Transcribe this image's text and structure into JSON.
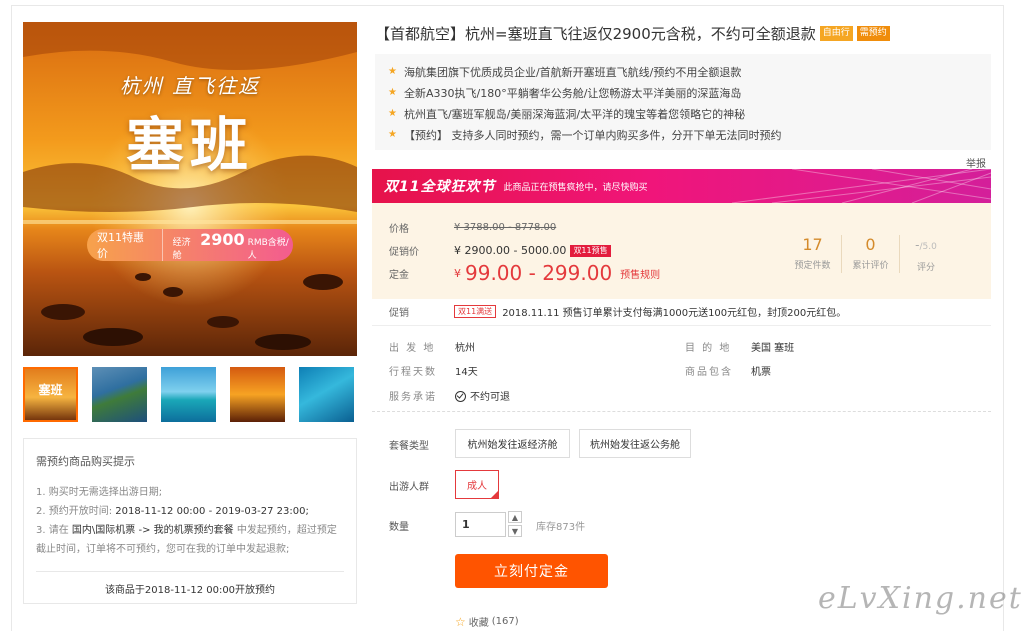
{
  "product": {
    "title": "【首都航空】杭州=塞班直飞往返仅2900元含税，不约可全额退款",
    "tags": [
      "自由行",
      "需预约"
    ]
  },
  "image": {
    "subtitle": "杭州 直飞往返",
    "title": "塞班",
    "pill_left": "双11特惠价",
    "pill_prefix": "经济舱",
    "pill_price": "2900",
    "pill_suffix": "RMB含税/人"
  },
  "thumbnails": [
    {
      "caption": "塞班"
    },
    {
      "caption": ""
    },
    {
      "caption": ""
    },
    {
      "caption": ""
    },
    {
      "caption": ""
    }
  ],
  "notice": {
    "title": "需预约商品购买提示",
    "line1": "1. 购买时无需选择出游日期;",
    "line2_label": "2. 预约开放时间:",
    "line2_value": "2018-11-12 00:00 - 2019-03-27 23:00;",
    "line3_a": "3. 请在",
    "line3_b": "国内\\国际机票 -> 我的机票预约套餐",
    "line3_c": "中发起预约，超过预定",
    "line4": "截止时间，订单将不可预约，您可在我的订单中发起退款;",
    "footer": "该商品于2018-11-12 00:00开放预约"
  },
  "features": [
    "海航集团旗下优质成员企业/首航新开塞班直飞航线/预约不用全额退款",
    "全新A330执飞/180°平躺奢华公务舱/让您畅游太平洋美丽的深蓝海岛",
    "杭州直飞/塞班军舰岛/美丽深海蓝洞/太平洋的瑰宝等着您领略它的神秘",
    "【预约】 支持多人同时预约，需一个订单内购买多件，分开下单无法同时预约"
  ],
  "report": "举报",
  "banner": {
    "logo": "双11全球狂欢节",
    "text": "此商品正在预售疯抢中，请尽快购买"
  },
  "price": {
    "label_price": "价格",
    "original": "¥ 3788.00 - 8778.00",
    "label_promo": "促销价",
    "promo": "¥ 2900.00 - 5000.00",
    "promo_badge": "双11预售",
    "label_deposit": "定金",
    "deposit_currency": "¥",
    "deposit": "99.00 - 299.00",
    "deposit_rule": "预售规则"
  },
  "stats": [
    {
      "num": "17",
      "label": "预定件数"
    },
    {
      "num": "0",
      "label": "累计评价"
    },
    {
      "num": "-",
      "sub": "/5.0",
      "label": "评分"
    }
  ],
  "promotion": {
    "label": "促销",
    "tag": "双11满送",
    "text": "2018.11.11 预售订单累计支付每满1000元送100元红包，封顶200元红包。"
  },
  "info": {
    "depart_k": "出 发 地",
    "depart_v": "杭州",
    "dest_k": "目 的 地",
    "dest_v": "美国  塞班",
    "days_k": "行程天数",
    "days_v": "14天",
    "include_k": "商品包含",
    "include_v": "机票",
    "service_k": "服务承诺",
    "service_v": "不约可退"
  },
  "options": {
    "package_label": "套餐类型",
    "package_1": "杭州始发往返经济舱",
    "package_2": "杭州始发往返公务舱",
    "group_label": "出游人群",
    "group_1": "成人",
    "qty_label": "数量",
    "qty_value": "1",
    "qty_up": "▲",
    "qty_down": "▼",
    "stock": "库存873件"
  },
  "cta": "立刻付定金",
  "favorite": {
    "label": "收藏",
    "count": "(167)"
  },
  "watermark": "eLvXing.net",
  "colors": {
    "accent": "#ff5400",
    "price_red": "#e4393c",
    "tag_orange": "#f5a623",
    "banner": "#e6134a"
  }
}
